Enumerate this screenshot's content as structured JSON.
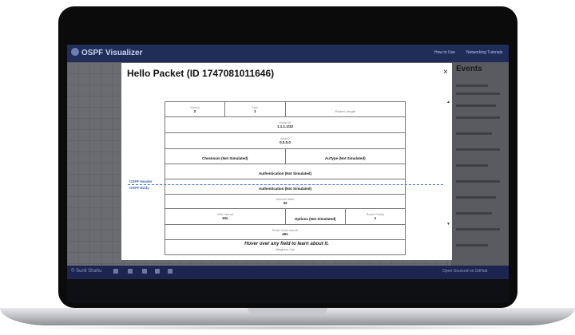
{
  "app": {
    "title": "OSPF Visualizer",
    "nav": [
      "How to Use",
      "Networking Tutorials"
    ],
    "events_title": "Events",
    "author": "© Sunil Shahu",
    "github_link": "Open-Sourced on GitHub"
  },
  "modal": {
    "title": "Hello Packet (ID 1747081011646)",
    "close_symbol": "×",
    "scroll_up_symbol": "▲",
    "scroll_down_symbol": "▼",
    "header_label": "OSPF Header",
    "body_label": "OSPF Body",
    "hint": "Hover over any field to learn about it.",
    "fields": {
      "version": {
        "label": "Version",
        "value": "2"
      },
      "type": {
        "label": "Type",
        "value": "1"
      },
      "packet_length": {
        "label": "Packet Length"
      },
      "router_id": {
        "label": "Router ID",
        "value": "1.1.1.1/32"
      },
      "area_id": {
        "label": "Area ID",
        "value": "0.0.0.0"
      },
      "checksum": "Checksum (Not Simulated)",
      "autype": "AuType (Not Simulated)",
      "auth1": "Authentication (Not Simulated)",
      "auth2": "Authentication (Not Simulated)",
      "network_mask": {
        "label": "Network Mask",
        "value": "32"
      },
      "hello_interval": {
        "label": "Hello Interval",
        "value": "10s"
      },
      "options": "Options (Not Simulated)",
      "router_priority": {
        "label": "Router Priority",
        "value": "1"
      },
      "dead_interval": {
        "label": "Router Dead Interval",
        "value": "40s"
      },
      "neighbor_list": "Neighbor List"
    }
  }
}
